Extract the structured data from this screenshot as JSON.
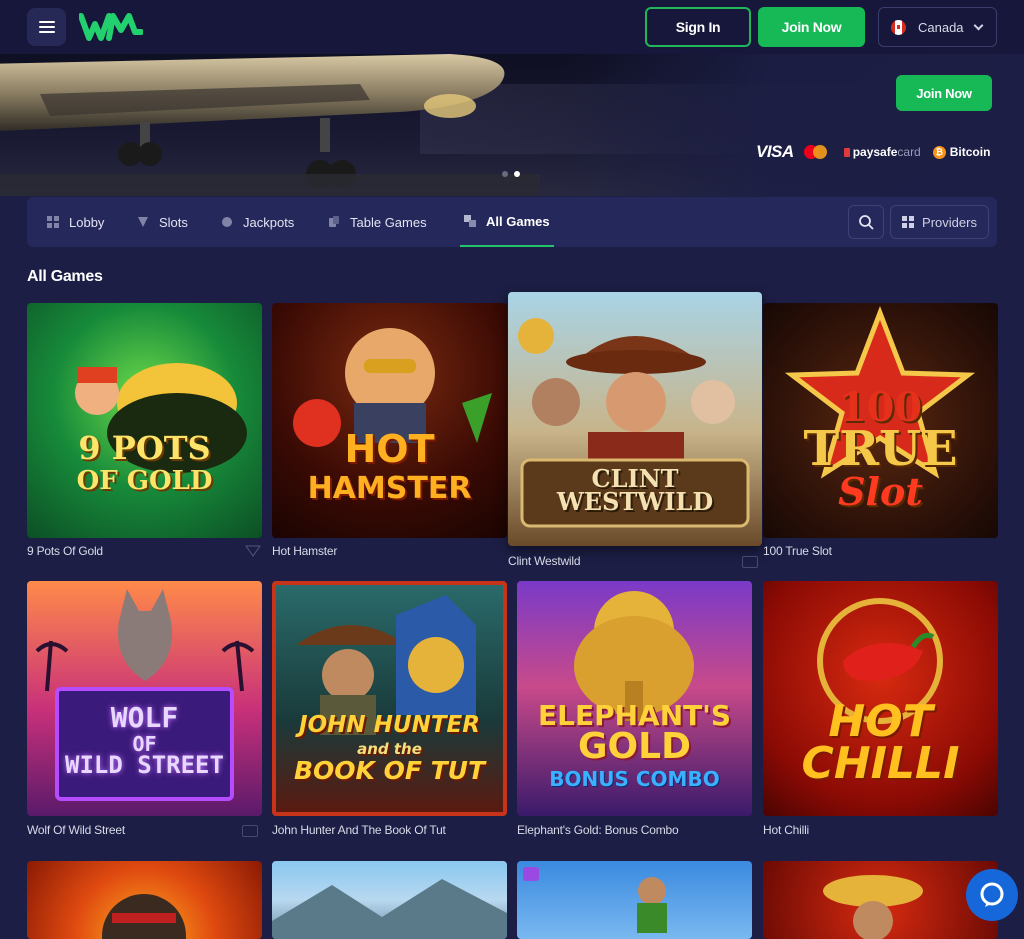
{
  "header": {
    "menu_icon": "hamburger-icon",
    "logo_text": "WM",
    "signin_label": "Sign In",
    "join_label": "Join Now",
    "country_label": "Canada",
    "country_flag": "canada-flag-icon"
  },
  "hero": {
    "join_label": "Join Now",
    "payments": {
      "visa": "VISA",
      "paysafe_bold": "paysafe",
      "paysafe_light": "card",
      "bitcoin": "Bitcoin"
    }
  },
  "nav": {
    "tabs": [
      {
        "label": "Lobby",
        "icon": "lobby-icon"
      },
      {
        "label": "Slots",
        "icon": "slots-icon"
      },
      {
        "label": "Jackpots",
        "icon": "jackpots-icon"
      },
      {
        "label": "Table Games",
        "icon": "table-games-icon"
      },
      {
        "label": "All Games",
        "icon": "all-games-icon",
        "active": true
      }
    ],
    "providers_label": "Providers"
  },
  "section_title": "All Games",
  "games": [
    {
      "name": "9 Pots Of Gold",
      "art_line1": "9 POTS",
      "art_line2": "OF GOLD"
    },
    {
      "name": "Hot Hamster",
      "art_line1": "HOT",
      "art_line2": "HAMSTER"
    },
    {
      "name": "Clint Westwild",
      "art_line1": "CLINT",
      "art_line2": "WESTWILD"
    },
    {
      "name": "100 True Slot",
      "art_line1": "100",
      "art_line2": "TRUE",
      "art_line3": "Slot"
    },
    {
      "name": "Wolf Of Wild Street",
      "art_line1": "WOLF",
      "art_line2": "OF",
      "art_line3": "WILD STREET"
    },
    {
      "name": "John Hunter And The Book Of Tut",
      "art_line1": "JOHN HUNTER",
      "art_line2": "and the",
      "art_line3": "BOOK OF TUT"
    },
    {
      "name": "Elephant's Gold: Bonus Combo",
      "art_line1": "ELEPHANT'S",
      "art_line2": "GOLD",
      "art_line3": "BONUS COMBO"
    },
    {
      "name": "Hot Chilli",
      "art_line1": "HOT",
      "art_line2": "CHILLI"
    }
  ],
  "colors": {
    "background": "#1c1e45",
    "header": "#16173a",
    "accent_green": "#17b957",
    "nav": "#25285a",
    "chat": "#1667d9"
  }
}
